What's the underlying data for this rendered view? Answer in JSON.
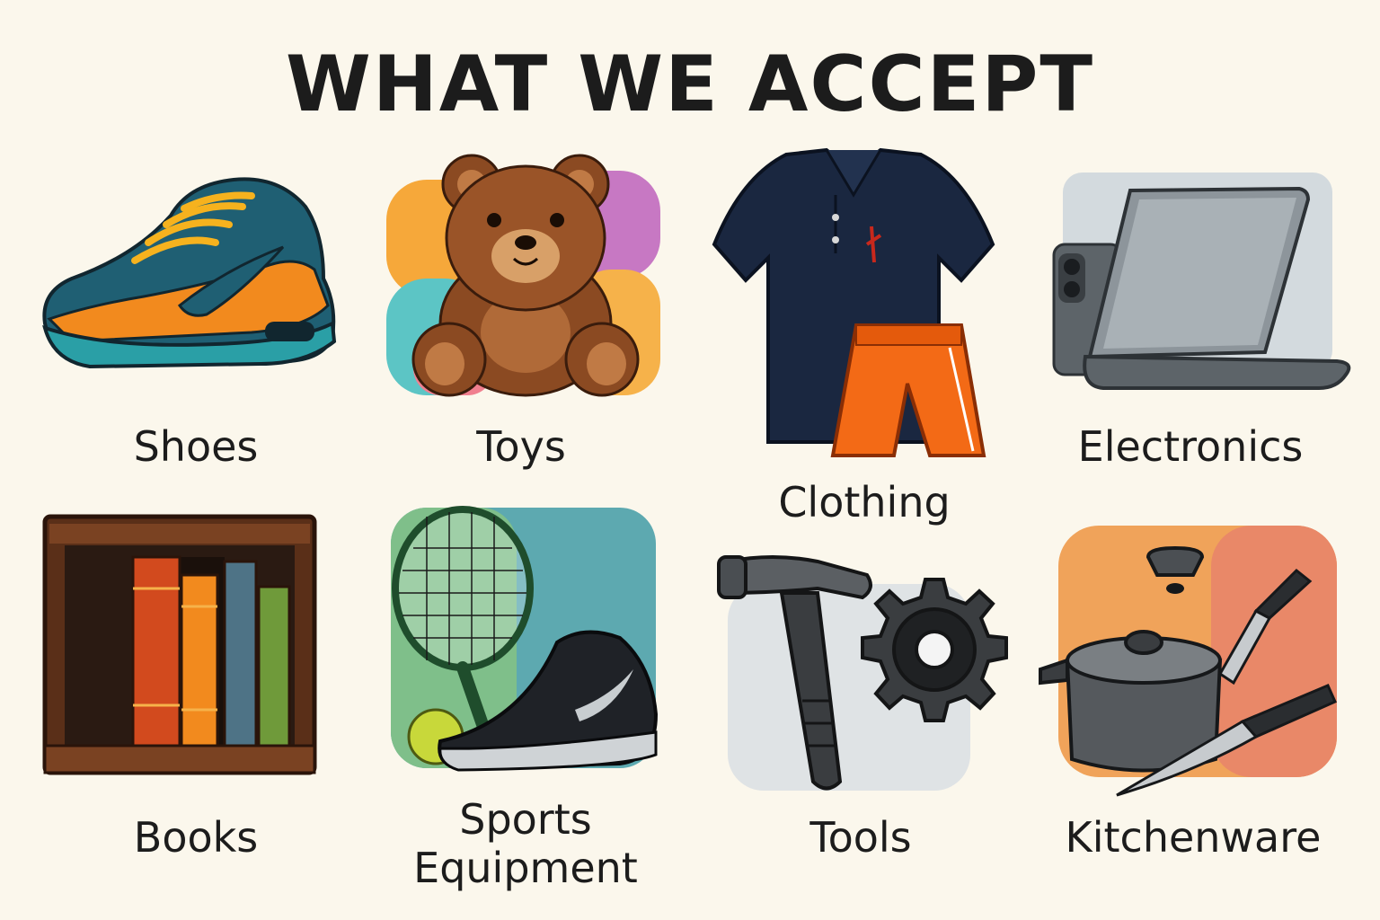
{
  "title": "WHAT WE ACCEPT",
  "categories": [
    {
      "label": "Shoes",
      "icon": "sneaker-icon"
    },
    {
      "label": "Toys",
      "icon": "teddy-bear-icon"
    },
    {
      "label": "Clothing",
      "icon": "polo-shirt-and-shorts-icon"
    },
    {
      "label": "Electronics",
      "icon": "laptop-and-phone-icon"
    },
    {
      "label": "Books",
      "icon": "bookshelf-icon"
    },
    {
      "label": "Sports Equipment",
      "icon": "tennis-racket-and-shoe-icon"
    },
    {
      "label": "Tools",
      "icon": "hammer-and-gear-icon"
    },
    {
      "label": "Kitchenware",
      "icon": "pot-and-knives-icon"
    }
  ],
  "colors": {
    "background": "#fbf7ec",
    "text": "#1c1c1c",
    "orange": "#f28a1e",
    "teal": "#1f5f73",
    "navy": "#1a2740",
    "brown": "#8b4a22"
  }
}
